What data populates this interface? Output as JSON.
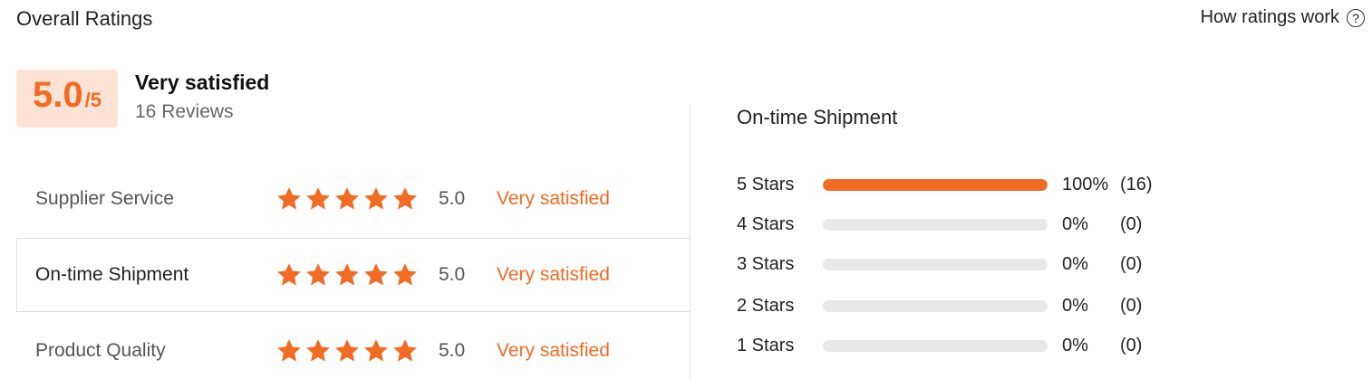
{
  "header": {
    "title": "Overall Ratings",
    "help_label": "How ratings work",
    "help_icon": "question-circle-icon"
  },
  "overall": {
    "score": "5.0",
    "out_of": "/5",
    "label": "Very satisfied",
    "reviews": "16 Reviews"
  },
  "colors": {
    "accent": "#f26b22",
    "score_bg": "#fde3d5",
    "track": "#e8e8e8"
  },
  "categories": [
    {
      "name": "Supplier Service",
      "stars": 5,
      "value": "5.0",
      "desc": "Very satisfied"
    },
    {
      "name": "On-time Shipment",
      "stars": 5,
      "value": "5.0",
      "desc": "Very satisfied"
    },
    {
      "name": "Product Quality",
      "stars": 5,
      "value": "5.0",
      "desc": "Very satisfied"
    }
  ],
  "distribution": {
    "title": "On-time Shipment",
    "rows": [
      {
        "label": "5  Stars",
        "fraction": 1.0,
        "percent": "100%",
        "count": "(16)"
      },
      {
        "label": "4  Stars",
        "fraction": 0,
        "percent": "0%",
        "count": "(0)"
      },
      {
        "label": "3  Stars",
        "fraction": 0,
        "percent": "0%",
        "count": "(0)"
      },
      {
        "label": "2  Stars",
        "fraction": 0,
        "percent": "0%",
        "count": "(0)"
      },
      {
        "label": "1  Stars",
        "fraction": 0,
        "percent": "0%",
        "count": "(0)"
      }
    ]
  }
}
